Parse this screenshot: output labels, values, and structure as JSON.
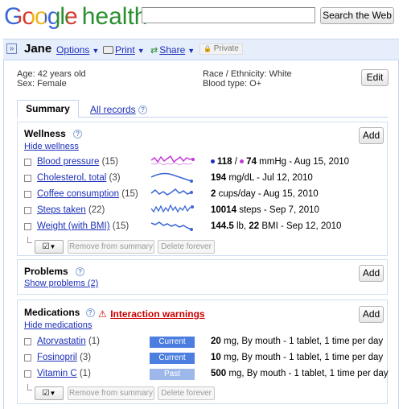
{
  "header": {
    "logo_google": "Google",
    "logo_product": "health",
    "search_value": "",
    "search_button": "Search the Web"
  },
  "profile_bar": {
    "expand_symbol": "»",
    "name": "Jane",
    "options_label": "Options",
    "print_label": "Print",
    "share_label": "Share",
    "private_label": "Private"
  },
  "profile_info": {
    "age_label": "Age:",
    "age_value": "42 years old",
    "sex_label": "Sex:",
    "sex_value": "Female",
    "race_label": "Race / Ethnicity:",
    "race_value": "White",
    "blood_label": "Blood type:",
    "blood_value": "O+",
    "edit_button": "Edit"
  },
  "tabs": [
    {
      "label": "Summary",
      "active": true
    },
    {
      "label": "All records",
      "active": false
    }
  ],
  "wellness": {
    "title": "Wellness",
    "hide_link": "Hide wellness",
    "add_button": "Add",
    "items": [
      {
        "name": "Blood pressure",
        "count": "(15)",
        "value_a": "118",
        "sep": "/",
        "value_b": "74",
        "rest": "mmHg - Aug 15, 2010",
        "sparkline_color": "#c13ad6"
      },
      {
        "name": "Cholesterol, total",
        "count": "(3)",
        "value_a": "194",
        "rest": "mg/dL - Jul 12, 2010",
        "sparkline_color": "#3a66d6"
      },
      {
        "name": "Coffee consumption",
        "count": "(15)",
        "value_a": "2",
        "rest": "cups/day - Aug 15, 2010",
        "sparkline_color": "#3a66d6"
      },
      {
        "name": "Steps taken",
        "count": "(22)",
        "value_a": "10014",
        "rest": "steps - Sep 7, 2010",
        "sparkline_color": "#3a66d6"
      },
      {
        "name": "Weight (with BMI)",
        "count": "(15)",
        "value_a": "144.5",
        "mid": "lb,",
        "value_b": "22",
        "rest": "BMI - Sep 12, 2010",
        "sparkline_color": "#3a66d6"
      }
    ],
    "remove_button": "Remove from summary",
    "delete_button": "Delete forever"
  },
  "problems": {
    "title": "Problems",
    "show_link": "Show problems (2)",
    "add_button": "Add"
  },
  "medications": {
    "title": "Medications",
    "warning_link": "Interaction warnings",
    "hide_link": "Hide medications",
    "add_button": "Add",
    "items": [
      {
        "name": "Atorvastatin",
        "count": "(1)",
        "status": "Current",
        "dose": "20",
        "rest": "mg, By mouth - 1 tablet, 1 time per day"
      },
      {
        "name": "Fosinopril",
        "count": "(3)",
        "status": "Current",
        "dose": "10",
        "rest": "mg, By mouth - 1 tablet, 1 time per day"
      },
      {
        "name": "Vitamin C",
        "count": "(1)",
        "status": "Past",
        "dose": "500",
        "rest": "mg, By mouth - 1 tablet, 1 time per day"
      }
    ],
    "remove_button": "Remove from summary",
    "delete_button": "Delete forever"
  },
  "colors": {
    "link": "#1c2fb8",
    "current_badge": "#4b7ee0",
    "past_badge": "#9db7ea",
    "warning": "#cc0000",
    "bp_systolic_dot": "#1c2fb8",
    "bp_diastolic_dot": "#c13ad6"
  }
}
